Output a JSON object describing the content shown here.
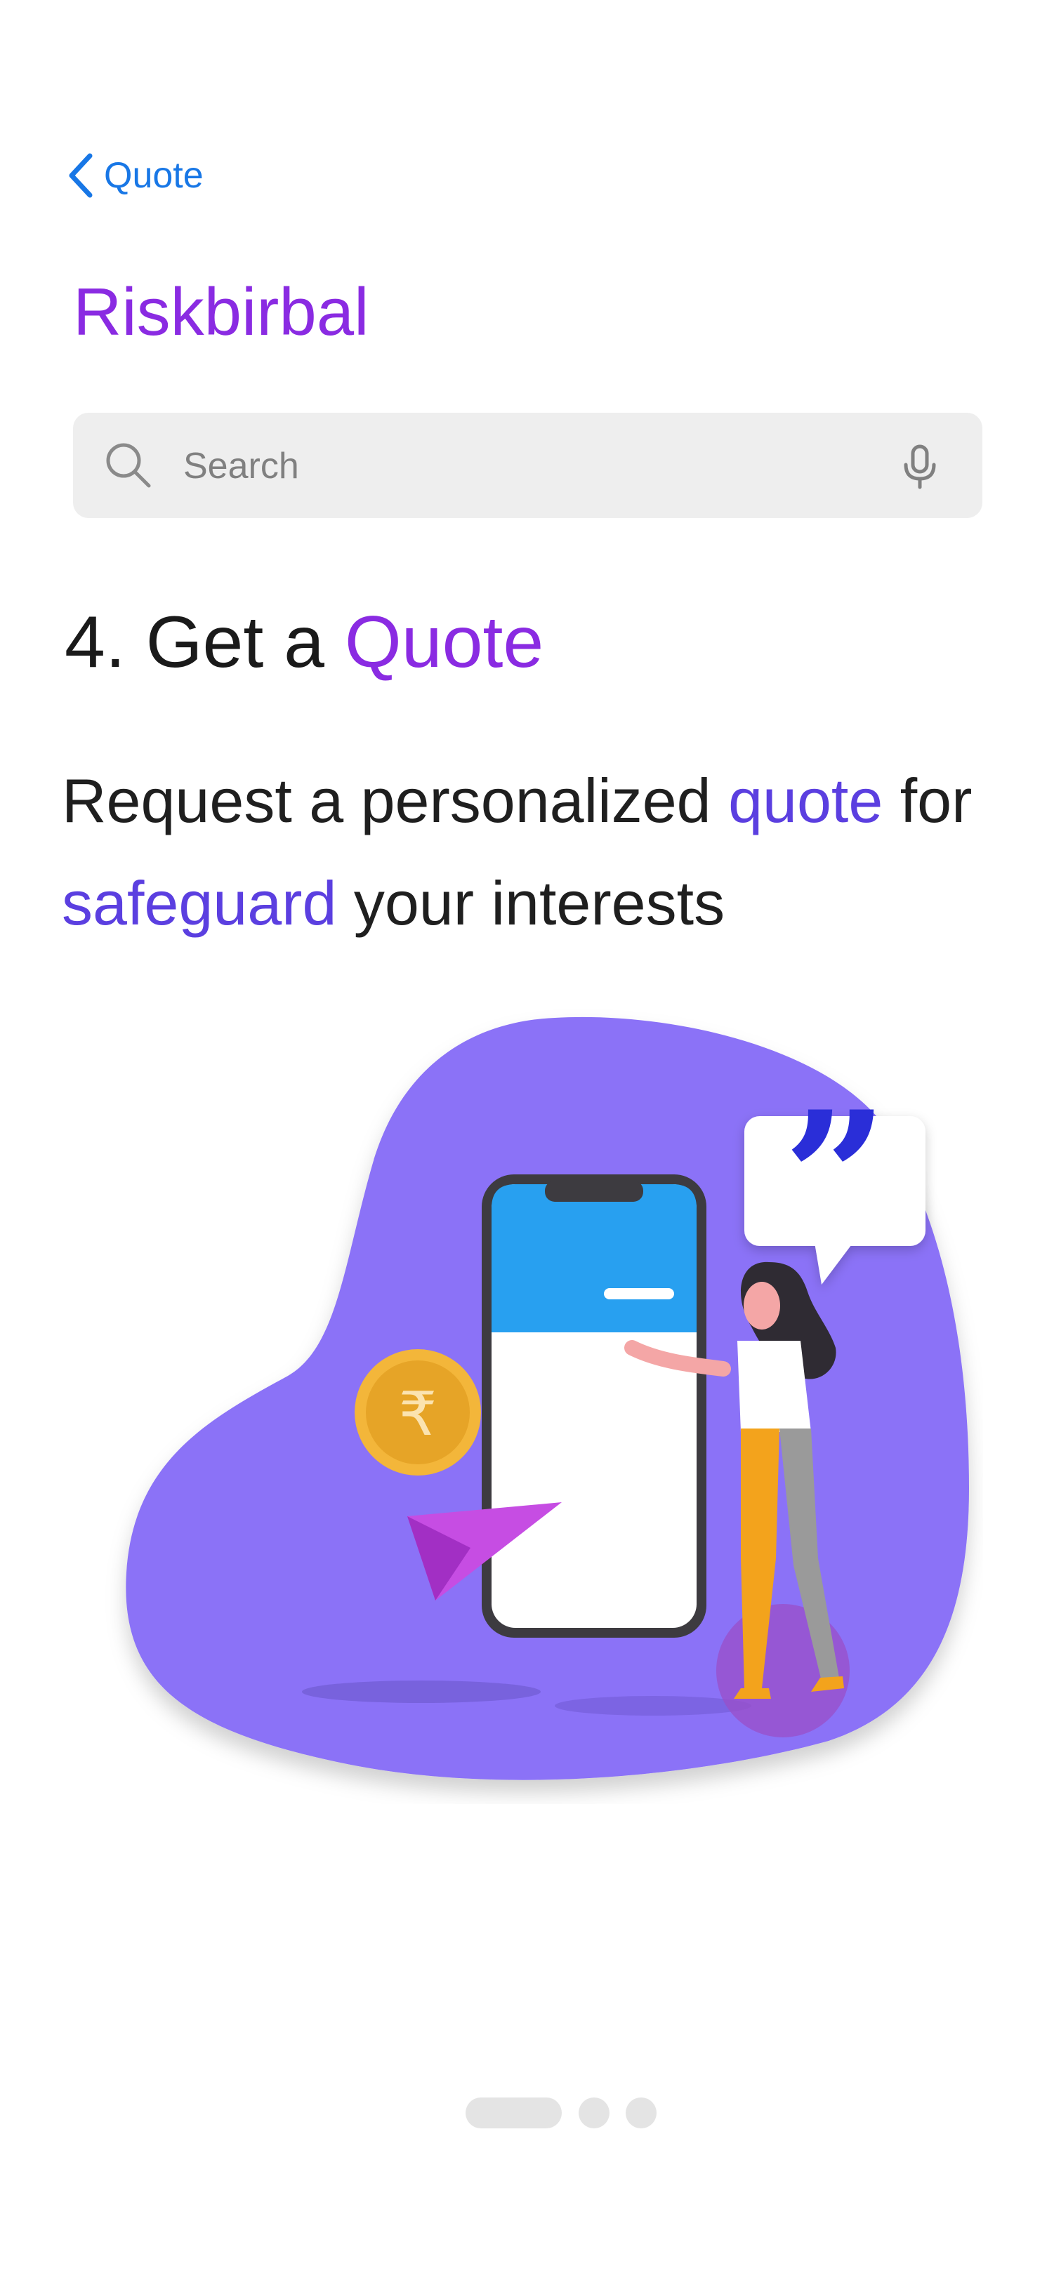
{
  "nav": {
    "back_label": "Quote",
    "back_icon": "chevron-left-icon"
  },
  "app": {
    "title": "Riskbirbal"
  },
  "search": {
    "placeholder": "Search",
    "value": "",
    "search_icon": "search-icon",
    "mic_icon": "microphone-icon"
  },
  "step": {
    "prefix": "4. Get a ",
    "highlight": "Quote"
  },
  "description": {
    "part1": "Request a personalized ",
    "highlight1": "quote",
    "part2": " for ",
    "highlight2": "safeguard",
    "part3": " your interests"
  },
  "illustration": {
    "currency_symbol": "₹",
    "quote_mark": "”"
  },
  "pager": {
    "total": 3,
    "active_index": 0
  },
  "colors": {
    "accent_purple": "#8a2be2",
    "accent_indigo": "#5b3fe0",
    "link_blue": "#1877e6",
    "blob": "#8b72f7",
    "search_bg": "#eeeeee"
  }
}
